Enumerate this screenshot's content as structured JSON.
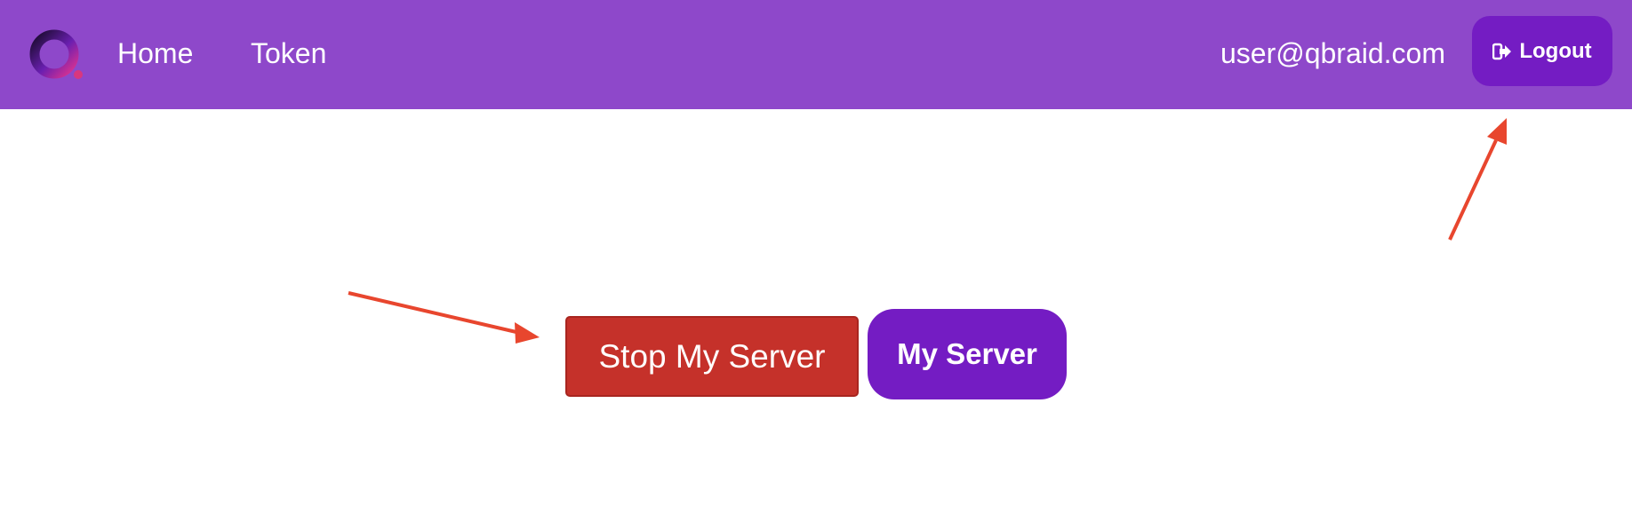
{
  "navbar": {
    "logo_icon": "qbraid-logo-icon",
    "links": [
      {
        "label": "Home"
      },
      {
        "label": "Token"
      }
    ],
    "user_email": "user@qbraid.com",
    "logout": {
      "label": "Logout",
      "icon": "sign-out-icon"
    }
  },
  "main": {
    "stop_server_label": "Stop My Server",
    "my_server_label": "My Server"
  },
  "colors": {
    "navbar_bg": "#8e48ca",
    "accent_purple": "#741cc3",
    "stop_red": "#c5312a",
    "annotation_arrow": "#e8462e"
  }
}
